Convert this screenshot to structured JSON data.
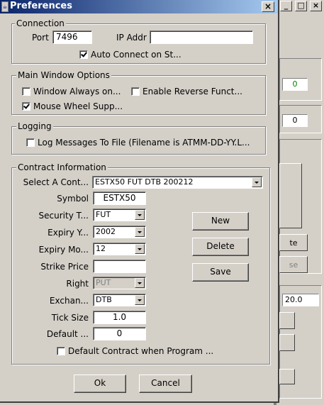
{
  "dialog": {
    "title": "Preferences",
    "close_glyph": "×",
    "ok_label": "Ok",
    "cancel_label": "Cancel"
  },
  "connection": {
    "label": "Connection",
    "port_label": "Port",
    "port_value": "7496",
    "ip_label": "IP Addr",
    "ip_value": "",
    "auto_connect_label": "Auto Connect on St...",
    "auto_connect_checked": true
  },
  "main_window": {
    "label": "Main Window Options",
    "always_on_label": "Window Always on...",
    "always_on_checked": false,
    "reverse_label": "Enable Reverse Funct...",
    "reverse_checked": false,
    "mouse_wheel_label": "Mouse Wheel Supp...",
    "mouse_wheel_checked": true
  },
  "logging": {
    "label": "Logging",
    "log_label": "Log Messages To File (Filename is ATMM-DD-YY.L...",
    "log_checked": false
  },
  "contract": {
    "label": "Contract Information",
    "select_label": "Select A Cont...",
    "select_value": "ESTX50 FUT DTB 200212",
    "symbol_label": "Symbol",
    "symbol_value": "ESTX50",
    "sectype_label": "Security T...",
    "sectype_value": "FUT",
    "expiry_year_label": "Expiry Y...",
    "expiry_year_value": "2002",
    "expiry_month_label": "Expiry Mo...",
    "expiry_month_value": "12",
    "strike_label": "Strike Price",
    "strike_value": "",
    "right_label": "Right",
    "right_value": "PUT",
    "exchange_label": "Exchan...",
    "exchange_value": "DTB",
    "tick_label": "Tick Size",
    "tick_value": "1.0",
    "default_label": "Default ...",
    "default_value": "0",
    "new_label": "New",
    "delete_label": "Delete",
    "save_label": "Save",
    "default_contract_label": "Default Contract when Program ...",
    "default_contract_checked": false
  },
  "background": {
    "min_glyph": "_",
    "max_glyph": "□",
    "close_glyph": "×",
    "field1_value": "0",
    "field1_color": "#008000",
    "field2_value": "0",
    "field3_value": "20.0",
    "btn1_fragment": "te",
    "btn2_fragment": "se"
  }
}
